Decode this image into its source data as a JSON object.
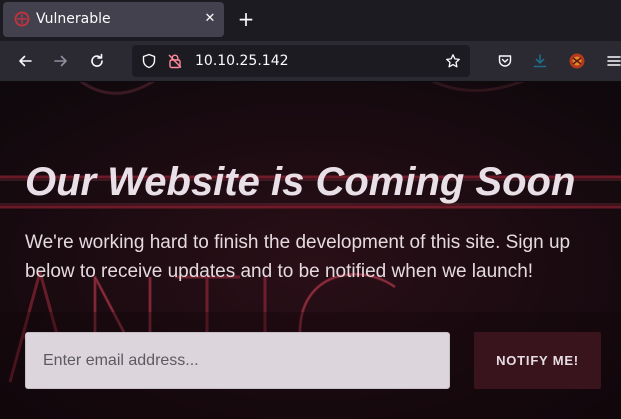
{
  "browser": {
    "tab_title": "Vulnerable",
    "tab_close_glyph": "✕",
    "new_tab_glyph": "+",
    "url": "10.10.25.142",
    "icons": [
      "back-arrow-icon",
      "forward-arrow-icon",
      "reload-icon",
      "shield-icon",
      "lock-icon",
      "star-icon",
      "pocket-icon",
      "download-icon",
      "extension-icon",
      "menu-icon"
    ]
  },
  "page": {
    "headline": "Our Website is Coming Soon",
    "subtext": "We're working hard to finish the development of this site. Sign up below to receive updates and to be notified when we launch!",
    "email_placeholder": "Enter email address...",
    "email_value": "",
    "notify_label": "NOTIFY ME!"
  },
  "colors": {
    "page_bg": "#140a0f",
    "neon": "#d2304a",
    "button_bg": "#3a141d",
    "input_bg": "#dcd5dc"
  }
}
